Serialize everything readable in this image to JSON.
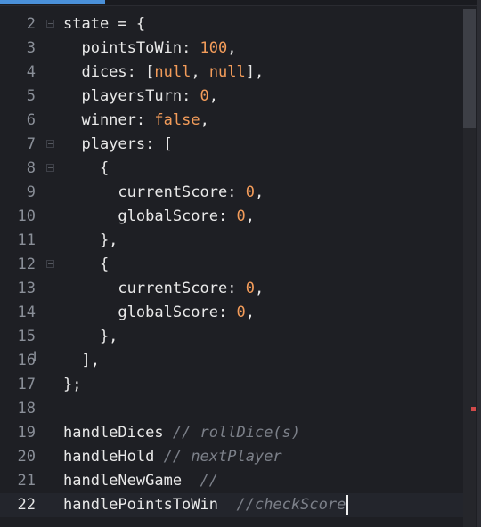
{
  "editor": {
    "current_line": "22",
    "lines": [
      {
        "num": "2",
        "fold": true,
        "tokens": [
          [
            "key",
            "state"
          ],
          [
            "punc",
            " = {"
          ]
        ]
      },
      {
        "num": "3",
        "fold": false,
        "tokens": [
          [
            "key",
            "  pointsToWin"
          ],
          [
            "punc",
            ": "
          ],
          [
            "num",
            "100"
          ],
          [
            "punc",
            ","
          ]
        ]
      },
      {
        "num": "4",
        "fold": false,
        "tokens": [
          [
            "key",
            "  dices"
          ],
          [
            "punc",
            ": ["
          ],
          [
            "kw",
            "null"
          ],
          [
            "punc",
            ", "
          ],
          [
            "kw",
            "null"
          ],
          [
            "punc",
            "],"
          ]
        ]
      },
      {
        "num": "5",
        "fold": false,
        "tokens": [
          [
            "key",
            "  playersTurn"
          ],
          [
            "punc",
            ": "
          ],
          [
            "num",
            "0"
          ],
          [
            "punc",
            ","
          ]
        ]
      },
      {
        "num": "6",
        "fold": false,
        "tokens": [
          [
            "key",
            "  winner"
          ],
          [
            "punc",
            ": "
          ],
          [
            "kw",
            "false"
          ],
          [
            "punc",
            ","
          ]
        ]
      },
      {
        "num": "7",
        "fold": true,
        "tokens": [
          [
            "key",
            "  players"
          ],
          [
            "punc",
            ": ["
          ]
        ]
      },
      {
        "num": "8",
        "fold": true,
        "tokens": [
          [
            "punc",
            "    {"
          ]
        ]
      },
      {
        "num": "9",
        "fold": false,
        "tokens": [
          [
            "key",
            "      currentScore"
          ],
          [
            "punc",
            ": "
          ],
          [
            "num",
            "0"
          ],
          [
            "punc",
            ","
          ]
        ]
      },
      {
        "num": "10",
        "fold": false,
        "tokens": [
          [
            "key",
            "      globalScore"
          ],
          [
            "punc",
            ": "
          ],
          [
            "num",
            "0"
          ],
          [
            "punc",
            ","
          ]
        ]
      },
      {
        "num": "11",
        "fold": false,
        "tokens": [
          [
            "punc",
            "    },"
          ]
        ]
      },
      {
        "num": "12",
        "fold": true,
        "tokens": [
          [
            "punc",
            "    {"
          ]
        ]
      },
      {
        "num": "13",
        "fold": false,
        "tokens": [
          [
            "key",
            "      currentScore"
          ],
          [
            "punc",
            ": "
          ],
          [
            "num",
            "0"
          ],
          [
            "punc",
            ","
          ]
        ]
      },
      {
        "num": "14",
        "fold": false,
        "tokens": [
          [
            "key",
            "      globalScore"
          ],
          [
            "punc",
            ": "
          ],
          [
            "num",
            "0"
          ],
          [
            "punc",
            ","
          ]
        ]
      },
      {
        "num": "15",
        "fold": false,
        "tokens": [
          [
            "punc",
            "    },"
          ]
        ]
      },
      {
        "num": "16",
        "fold": false,
        "tokens": [
          [
            "punc",
            "  ],"
          ]
        ]
      },
      {
        "num": "17",
        "fold": false,
        "tokens": [
          [
            "punc",
            "};"
          ]
        ]
      },
      {
        "num": "18",
        "fold": false,
        "tokens": []
      },
      {
        "num": "19",
        "fold": false,
        "tokens": [
          [
            "key",
            "handleDices"
          ],
          [
            "punc",
            " "
          ],
          [
            "comment",
            "// rollDice(s)"
          ]
        ]
      },
      {
        "num": "20",
        "fold": false,
        "tokens": [
          [
            "key",
            "handleHold"
          ],
          [
            "punc",
            " "
          ],
          [
            "comment",
            "// nextPlayer"
          ]
        ]
      },
      {
        "num": "21",
        "fold": false,
        "tokens": [
          [
            "key",
            "handleNewGame"
          ],
          [
            "punc",
            "  "
          ],
          [
            "comment",
            "//"
          ]
        ]
      },
      {
        "num": "22",
        "fold": false,
        "tokens": [
          [
            "key",
            "handlePointsToWin"
          ],
          [
            "punc",
            "  "
          ],
          [
            "comment",
            "//checkScore"
          ]
        ]
      }
    ]
  },
  "colors": {
    "background": "#1e1f24",
    "number": "#f39c5a",
    "keyword": "#f39c5a",
    "comment": "#7c8089",
    "text": "#e9e9e9",
    "gutter": "#8a8f98"
  }
}
